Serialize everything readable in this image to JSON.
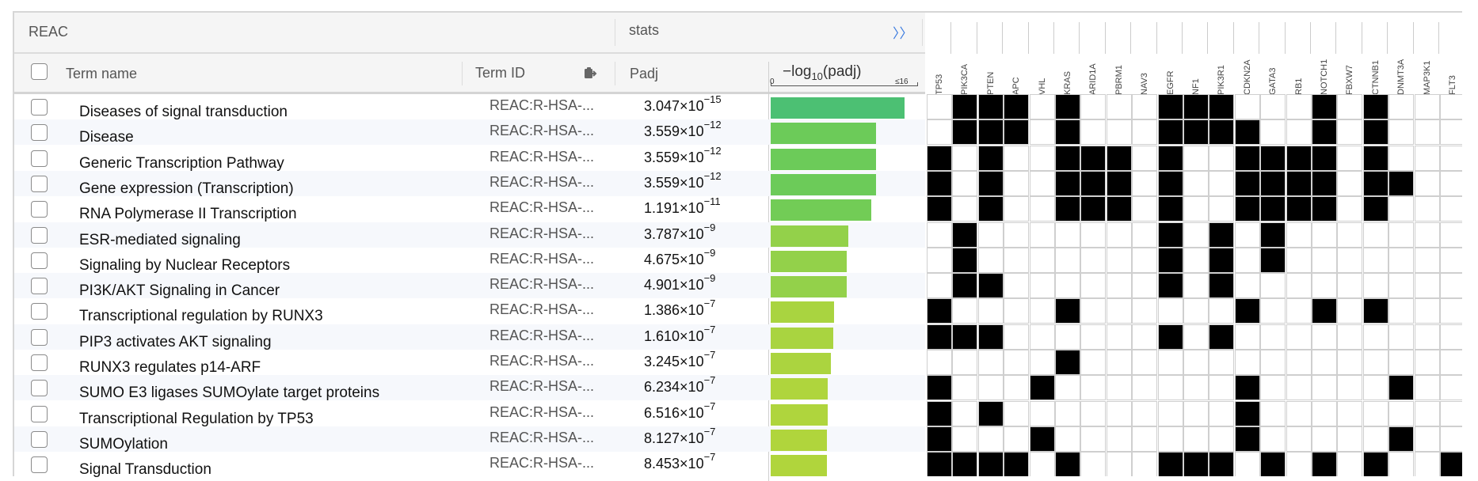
{
  "header": {
    "source": "REAC",
    "stats": "stats",
    "expand": "〉〉",
    "col_term": "Term name",
    "col_id": "Term ID",
    "col_padj": "Padj",
    "col_log": "−log",
    "col_log_sub": "10",
    "col_log_tail": "(padj)",
    "tick_min": "0",
    "tick_max": "≤16"
  },
  "genes": [
    "TP53",
    "PIK3CA",
    "PTEN",
    "APC",
    "VHL",
    "KRAS",
    "ARID1A",
    "PBRM1",
    "NAV3",
    "EGFR",
    "NF1",
    "PIK3R1",
    "CDKN2A",
    "GATA3",
    "RB1",
    "NOTCH1",
    "FBXW7",
    "CTNNB1",
    "DNMT3A",
    "MAP3K1",
    "FLT3"
  ],
  "rows": [
    {
      "term": "Diseases of signal transduction",
      "id": "REAC:R-HSA-...",
      "mant": "3.047×10",
      "exp": "−15",
      "neglog": 14.5,
      "color": "#4cc073",
      "genes": [
        0,
        1,
        1,
        1,
        0,
        1,
        0,
        0,
        0,
        1,
        1,
        1,
        0,
        0,
        0,
        1,
        0,
        1,
        0,
        0,
        0
      ]
    },
    {
      "term": "Disease",
      "id": "REAC:R-HSA-...",
      "mant": "3.559×10",
      "exp": "−12",
      "neglog": 11.4,
      "color": "#6ccb59",
      "genes": [
        0,
        1,
        1,
        1,
        0,
        1,
        0,
        0,
        0,
        1,
        1,
        1,
        1,
        0,
        0,
        1,
        0,
        1,
        0,
        0,
        0
      ]
    },
    {
      "term": "Generic Transcription Pathway",
      "id": "REAC:R-HSA-...",
      "mant": "3.559×10",
      "exp": "−12",
      "neglog": 11.4,
      "color": "#6ccb59",
      "genes": [
        1,
        0,
        1,
        0,
        0,
        1,
        1,
        1,
        0,
        1,
        0,
        0,
        1,
        1,
        1,
        1,
        0,
        1,
        0,
        0,
        0
      ]
    },
    {
      "term": "Gene expression (Transcription)",
      "id": "REAC:R-HSA-...",
      "mant": "3.559×10",
      "exp": "−12",
      "neglog": 11.4,
      "color": "#6ccb59",
      "genes": [
        1,
        0,
        1,
        0,
        0,
        1,
        1,
        1,
        0,
        1,
        0,
        0,
        1,
        1,
        1,
        1,
        0,
        1,
        1,
        0,
        0
      ]
    },
    {
      "term": "RNA Polymerase II Transcription",
      "id": "REAC:R-HSA-...",
      "mant": "1.191×10",
      "exp": "−11",
      "neglog": 10.9,
      "color": "#72cc56",
      "genes": [
        1,
        0,
        1,
        0,
        0,
        1,
        1,
        1,
        0,
        1,
        0,
        0,
        1,
        1,
        1,
        1,
        0,
        1,
        0,
        0,
        0
      ]
    },
    {
      "term": "ESR-mediated signaling",
      "id": "REAC:R-HSA-...",
      "mant": "3.787×10",
      "exp": "−9",
      "neglog": 8.4,
      "color": "#93d14a",
      "genes": [
        0,
        1,
        0,
        0,
        0,
        0,
        0,
        0,
        0,
        1,
        0,
        1,
        0,
        1,
        0,
        0,
        0,
        0,
        0,
        0,
        0
      ]
    },
    {
      "term": "Signaling by Nuclear Receptors",
      "id": "REAC:R-HSA-...",
      "mant": "4.675×10",
      "exp": "−9",
      "neglog": 8.3,
      "color": "#93d14a",
      "genes": [
        0,
        1,
        0,
        0,
        0,
        0,
        0,
        0,
        0,
        1,
        0,
        1,
        0,
        1,
        0,
        0,
        0,
        0,
        0,
        0,
        0
      ]
    },
    {
      "term": "PI3K/AKT Signaling in Cancer",
      "id": "REAC:R-HSA-...",
      "mant": "4.901×10",
      "exp": "−9",
      "neglog": 8.3,
      "color": "#93d14a",
      "genes": [
        0,
        1,
        1,
        0,
        0,
        0,
        0,
        0,
        0,
        1,
        0,
        1,
        0,
        0,
        0,
        0,
        0,
        0,
        0,
        0,
        0
      ]
    },
    {
      "term": "Transcriptional regulation by RUNX3",
      "id": "REAC:R-HSA-...",
      "mant": "1.386×10",
      "exp": "−7",
      "neglog": 6.9,
      "color": "#a9d440",
      "genes": [
        1,
        0,
        0,
        0,
        0,
        1,
        0,
        0,
        0,
        0,
        0,
        0,
        1,
        0,
        0,
        1,
        0,
        1,
        0,
        0,
        0
      ]
    },
    {
      "term": "PIP3 activates AKT signaling",
      "id": "REAC:R-HSA-...",
      "mant": "1.610×10",
      "exp": "−7",
      "neglog": 6.8,
      "color": "#a9d440",
      "genes": [
        1,
        1,
        1,
        0,
        0,
        0,
        0,
        0,
        0,
        1,
        0,
        1,
        0,
        0,
        0,
        0,
        0,
        0,
        0,
        0,
        0
      ]
    },
    {
      "term": "RUNX3 regulates p14-ARF",
      "id": "REAC:R-HSA-...",
      "mant": "3.245×10",
      "exp": "−7",
      "neglog": 6.5,
      "color": "#abd43f",
      "genes": [
        0,
        0,
        0,
        0,
        0,
        1,
        0,
        0,
        0,
        0,
        0,
        0,
        0,
        0,
        0,
        0,
        0,
        0,
        0,
        0,
        0
      ]
    },
    {
      "term": "SUMO E3 ligases SUMOylate target proteins",
      "id": "REAC:R-HSA-...",
      "mant": "6.234×10",
      "exp": "−7",
      "neglog": 6.2,
      "color": "#afd53d",
      "genes": [
        1,
        0,
        0,
        0,
        1,
        0,
        0,
        0,
        0,
        0,
        0,
        0,
        1,
        0,
        0,
        0,
        0,
        0,
        1,
        0,
        0
      ]
    },
    {
      "term": "Transcriptional Regulation by TP53",
      "id": "REAC:R-HSA-...",
      "mant": "6.516×10",
      "exp": "−7",
      "neglog": 6.2,
      "color": "#afd53d",
      "genes": [
        1,
        0,
        1,
        0,
        0,
        0,
        0,
        0,
        0,
        0,
        0,
        0,
        1,
        0,
        0,
        0,
        0,
        0,
        0,
        0,
        0
      ]
    },
    {
      "term": "SUMOylation",
      "id": "REAC:R-HSA-...",
      "mant": "8.127×10",
      "exp": "−7",
      "neglog": 6.1,
      "color": "#b0d53c",
      "genes": [
        1,
        0,
        0,
        0,
        1,
        0,
        0,
        0,
        0,
        0,
        0,
        0,
        1,
        0,
        0,
        0,
        0,
        0,
        1,
        0,
        0
      ]
    },
    {
      "term": "Signal Transduction",
      "id": "REAC:R-HSA-...",
      "mant": "8.453×10",
      "exp": "−7",
      "neglog": 6.1,
      "color": "#b0d53c",
      "genes": [
        1,
        1,
        1,
        1,
        0,
        1,
        0,
        0,
        0,
        1,
        1,
        1,
        0,
        1,
        0,
        1,
        0,
        1,
        0,
        0,
        1
      ]
    }
  ]
}
